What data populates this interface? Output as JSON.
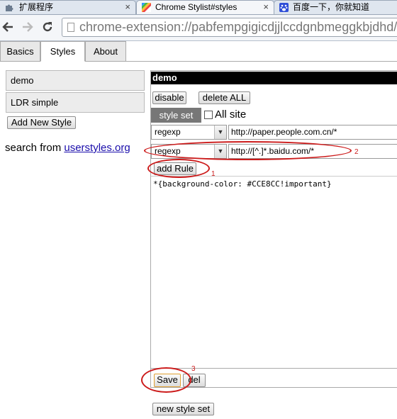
{
  "browser": {
    "tabs": [
      {
        "title": "扩展程序",
        "icon": "puzzle-icon",
        "active": false
      },
      {
        "title": "Chrome Stylist#styles",
        "icon": "stylist-icon",
        "active": true
      },
      {
        "title": "百度一下，你就知道",
        "icon": "baidu-paw-icon",
        "active": false
      }
    ],
    "tab_close_glyph": "×",
    "address": "chrome-extension://pabfempgigicdjjlccdgnbmeggkbjdhd/c"
  },
  "ext_tabs": [
    "Basics",
    "Styles",
    "About"
  ],
  "sidebar": {
    "styles": [
      "demo",
      "LDR simple"
    ],
    "add_button": "Add New Style",
    "search_prefix": "search from ",
    "search_link": "userstyles.org"
  },
  "editor": {
    "title": "demo",
    "disable_button": "disable",
    "delete_all_button": "delete ALL",
    "style_set_tab": "style set",
    "all_site_label": "All site",
    "rules": [
      {
        "type": "regexp",
        "pattern": "http://paper.people.com.cn/*"
      },
      {
        "type": "regexp",
        "pattern": "http://[^.]*.baidu.com/*"
      }
    ],
    "add_rule_button": "add Rule",
    "css_code": "*{background-color: #CCE8CC!important}",
    "save_button": "Save",
    "del_button": "del",
    "new_style_set_button": "new style set"
  },
  "annotations": {
    "marks": [
      "1",
      "2",
      "3"
    ],
    "color": "#cc1b1b"
  }
}
